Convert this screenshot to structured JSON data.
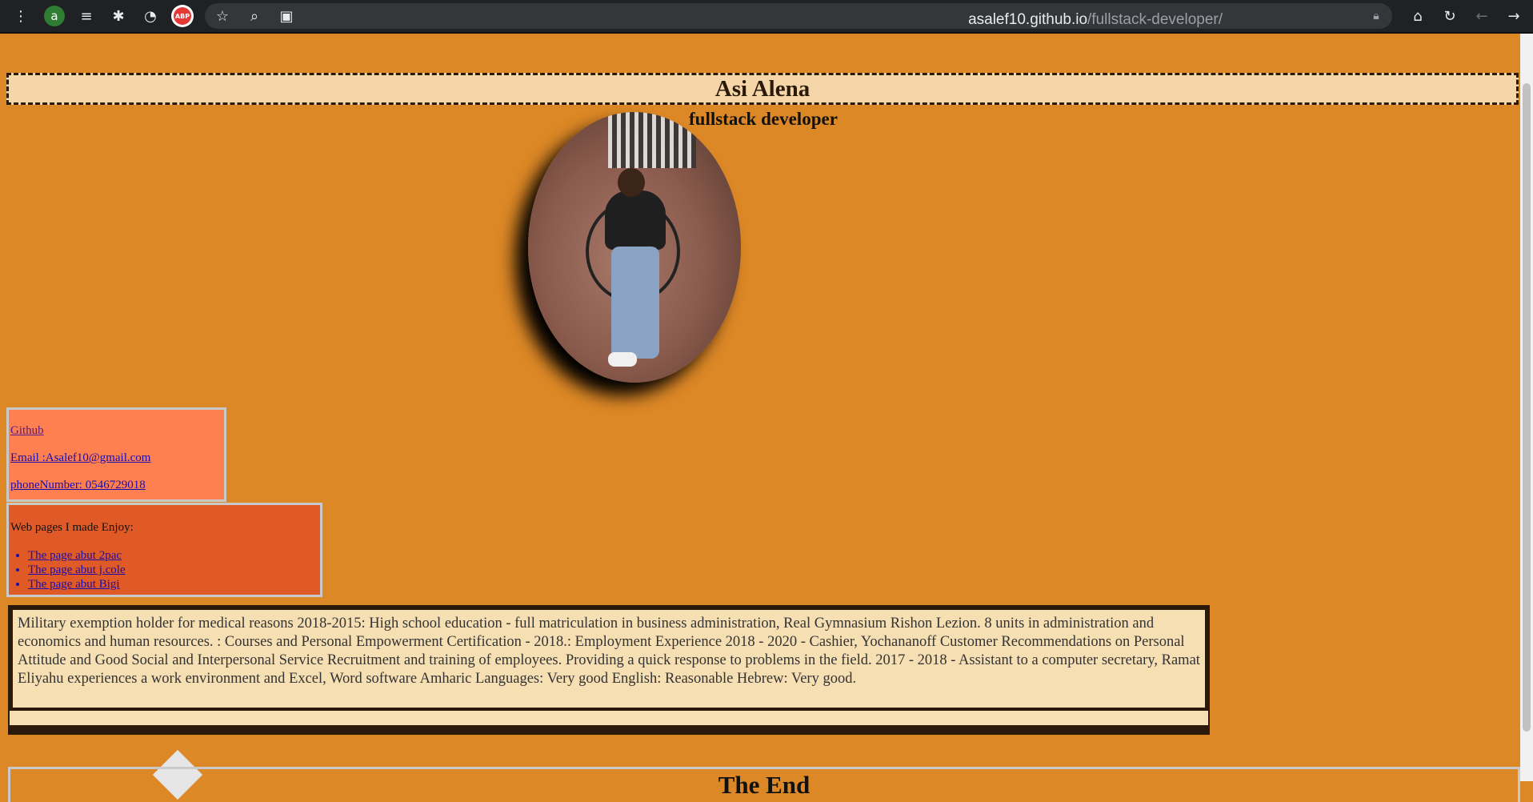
{
  "browser": {
    "profile_initial": "a",
    "adblock_label": "ABP",
    "url_host": "asalef10.github.io",
    "url_path": "/fullstack-developer/"
  },
  "page": {
    "name": "Asi Alena",
    "subtitle": "fullstack developer",
    "contacts": {
      "github": "Github",
      "email": "Email :Asalef10@gmail.com",
      "phone": "phoneNumber: 0546729018"
    },
    "webpages": {
      "intro": "Web pages I made Enjoy:",
      "links": [
        "The page abut 2pac",
        "The page abut j.cole",
        "The page abut Bigi"
      ]
    },
    "bio": "Military exemption holder for medical reasons 2018-2015: High school education - full matriculation in business administration, Real Gymnasium Rishon Lezion. 8 units in administration and economics and human resources. : Courses and Personal Empowerment Certification - 2018.: Employment Experience 2018 - 2020 - Cashier, Yochananoff Customer Recommendations on Personal Attitude and Good Social and Interpersonal Service Recruitment and training of employees. Providing a quick response to problems in the field. 2017 - 2018 - Assistant to a computer secretary, Ramat Eliyahu experiences a work environment and Excel, Word software Amharic Languages: Very good English: Reasonable Hebrew: Very good.",
    "footer": "The End"
  }
}
